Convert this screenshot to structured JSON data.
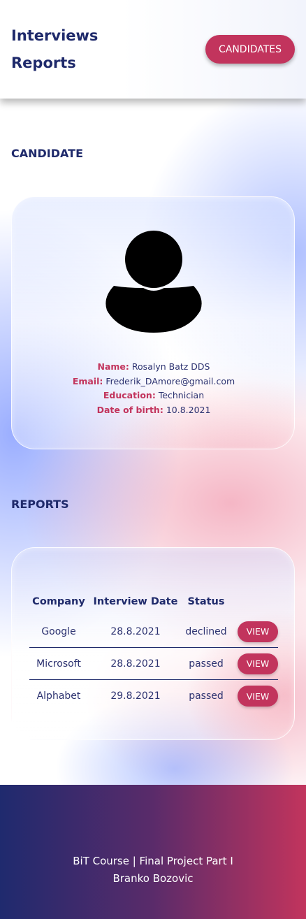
{
  "header": {
    "brand_line1": "Interviews",
    "brand_line2": "Reports",
    "nav_button": "CANDIDATES"
  },
  "candidate_section": {
    "title": "CANDIDATE",
    "avatar_icon": "user-silhouette-icon",
    "fields": {
      "name_label": "Name:",
      "name_value": "Rosalyn Batz DDS",
      "email_label": "Email:",
      "email_value": "Frederik_DAmore@gmail.com",
      "education_label": "Education:",
      "education_value": "Technician",
      "dob_label": "Date of birth:",
      "dob_value": "10.8.2021"
    }
  },
  "reports_section": {
    "title": "REPORTS",
    "columns": [
      "Company",
      "Interview Date",
      "Status"
    ],
    "rows": [
      {
        "company": "Google",
        "date": "28.8.2021",
        "status": "declined",
        "action": "VIEW"
      },
      {
        "company": "Microsoft",
        "date": "28.8.2021",
        "status": "passed",
        "action": "VIEW"
      },
      {
        "company": "Alphabet",
        "date": "29.8.2021",
        "status": "passed",
        "action": "VIEW"
      }
    ]
  },
  "footer": {
    "line1": "BiT Course | Final Project Part I",
    "line2": "Branko Bozovic"
  },
  "colors": {
    "primary_navy": "#1f2a6b",
    "accent_crimson": "#c2345d"
  }
}
